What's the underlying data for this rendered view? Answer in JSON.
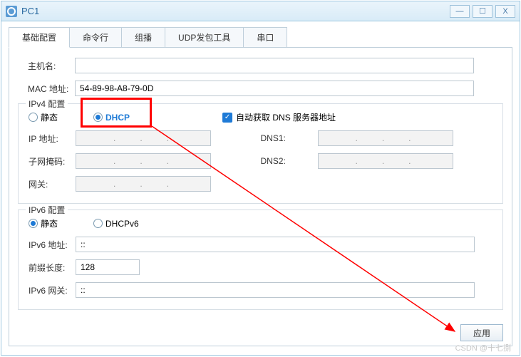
{
  "window": {
    "title": "PC1"
  },
  "tabs": {
    "basic": "基础配置",
    "cmd": "命令行",
    "multicast": "组播",
    "udp": "UDP发包工具",
    "serial": "串口"
  },
  "host": {
    "hostname_label": "主机名:",
    "hostname_value": "",
    "mac_label": "MAC 地址:",
    "mac_value": "54-89-98-A8-79-0D"
  },
  "ipv4": {
    "section": "IPv4 配置",
    "static_label": "静态",
    "dhcp_label": "DHCP",
    "auto_dns_label": "自动获取 DNS 服务器地址",
    "ip_label": "IP 地址:",
    "mask_label": "子网掩码:",
    "gw_label": "网关:",
    "dns1_label": "DNS1:",
    "dns2_label": "DNS2:",
    "dots": ".   .   ."
  },
  "ipv6": {
    "section": "IPv6 配置",
    "static_label": "静态",
    "dhcpv6_label": "DHCPv6",
    "addr_label": "IPv6 地址:",
    "addr_value": "::",
    "prefix_label": "前缀长度:",
    "prefix_value": "128",
    "gw_label": "IPv6 网关:",
    "gw_value": "::"
  },
  "buttons": {
    "apply": "应用"
  },
  "watermark": "CSDN @十七捌"
}
